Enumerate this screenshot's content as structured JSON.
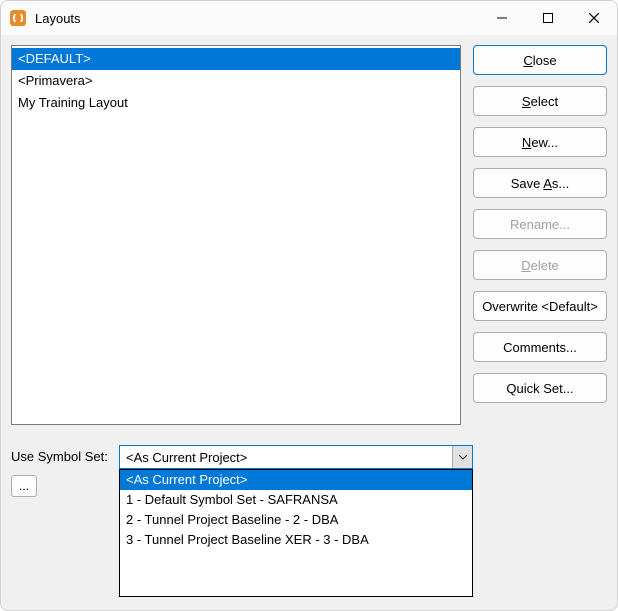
{
  "window": {
    "title": "Layouts"
  },
  "layouts": {
    "items": [
      {
        "label": "<DEFAULT>",
        "selected": true
      },
      {
        "label": "<Primavera>",
        "selected": false
      },
      {
        "label": "My Training Layout",
        "selected": false
      }
    ]
  },
  "buttons": {
    "close": "Close",
    "select": "Select",
    "new": "New...",
    "save_as": "Save As...",
    "rename": "Rename...",
    "delete": "Delete",
    "overwrite": "Overwrite <Default>",
    "comments": "Comments...",
    "quick_set": "Quick Set..."
  },
  "symbol_set": {
    "label": "Use Symbol Set:",
    "value": "<As Current Project>",
    "options": [
      {
        "label": "<As Current Project>",
        "selected": true
      },
      {
        "label": "1 - Default Symbol Set - SAFRANSA",
        "selected": false
      },
      {
        "label": "2 - Tunnel Project Baseline - 2 - DBA",
        "selected": false
      },
      {
        "label": "3 - Tunnel Project Baseline XER - 3 - DBA",
        "selected": false
      }
    ]
  },
  "ellipsis": "..."
}
